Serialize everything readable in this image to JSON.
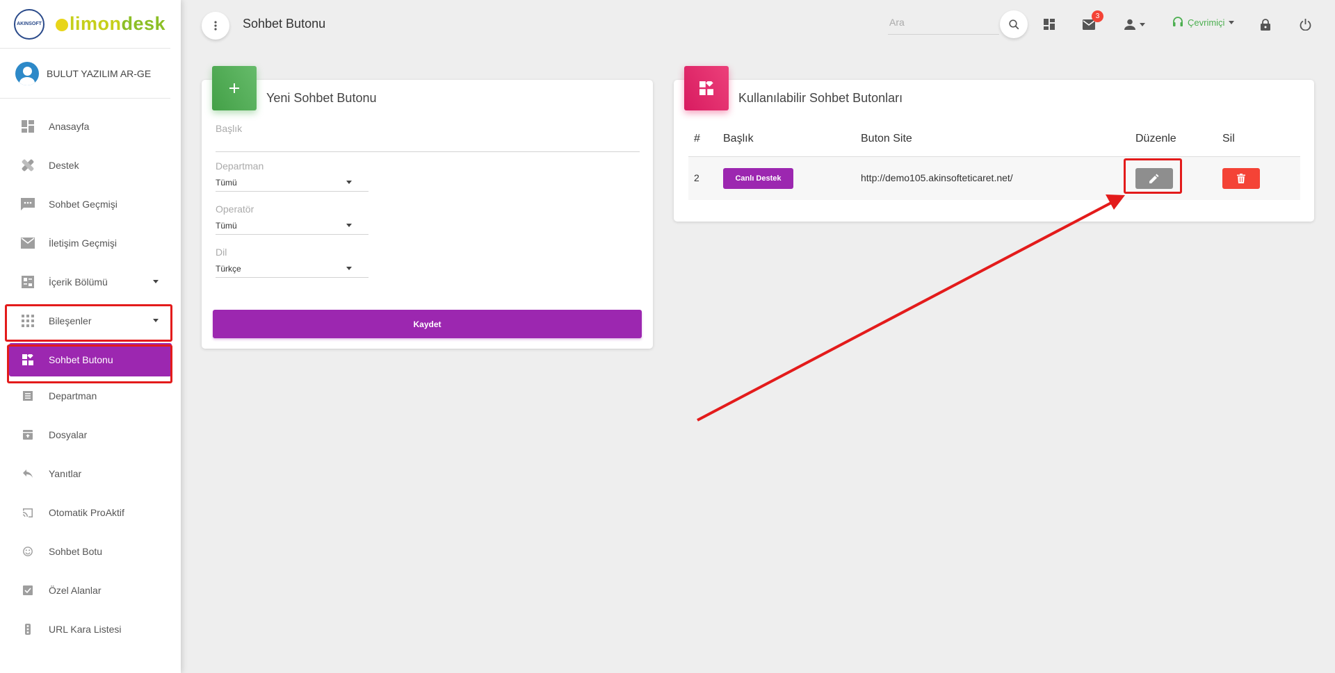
{
  "brand": {
    "emblem": "AKINSOFT",
    "name_part1": "limon",
    "name_part2": "desk"
  },
  "user": {
    "name": "BULUT YAZILIM AR-GE"
  },
  "sidebar": {
    "items": [
      {
        "label": "Anasayfa",
        "icon": "dashboard-icon"
      },
      {
        "label": "Destek",
        "icon": "support-icon"
      },
      {
        "label": "Sohbet Geçmişi",
        "icon": "chat-icon"
      },
      {
        "label": "İletişim Geçmişi",
        "icon": "mail-icon"
      },
      {
        "label": "İçerik Bölümü",
        "icon": "content-icon"
      },
      {
        "label": "Bileşenler",
        "icon": "apps-icon"
      }
    ],
    "sub_items": [
      {
        "label": "Sohbet Butonu",
        "icon": "widgets-icon",
        "active": true
      },
      {
        "label": "Departman",
        "icon": "list-icon"
      },
      {
        "label": "Dosyalar",
        "icon": "archive-icon"
      },
      {
        "label": "Yanıtlar",
        "icon": "reply-icon"
      },
      {
        "label": "Otomatik ProAktif",
        "icon": "cast-icon"
      },
      {
        "label": "Sohbet Botu",
        "icon": "smile-icon"
      },
      {
        "label": "Özel Alanlar",
        "icon": "checkbox-icon"
      },
      {
        "label": "URL Kara Listesi",
        "icon": "traffic-icon"
      }
    ]
  },
  "header": {
    "title": "Sohbet Butonu",
    "search_placeholder": "Ara",
    "mail_badge": "3",
    "status": "Çevrimiçi"
  },
  "new_button_card": {
    "title": "Yeni Sohbet Butonu",
    "fields": {
      "title_label": "Başlık",
      "department_label": "Departman",
      "department_value": "Tümü",
      "operator_label": "Operatör",
      "operator_value": "Tümü",
      "language_label": "Dil",
      "language_value": "Türkçe"
    },
    "save_label": "Kaydet"
  },
  "available_card": {
    "title": "Kullanılabilir Sohbet Butonları",
    "columns": [
      "#",
      "Başlık",
      "Buton Site",
      "Düzenle",
      "Sil"
    ],
    "rows": [
      {
        "id": "2",
        "title": "Canlı Destek",
        "site": "http://demo105.akinsofteticaret.net/"
      }
    ]
  },
  "colors": {
    "accent": "#9c27b0",
    "danger": "#f44336",
    "success": "#4caf50",
    "annotation": "#e31b1b"
  }
}
